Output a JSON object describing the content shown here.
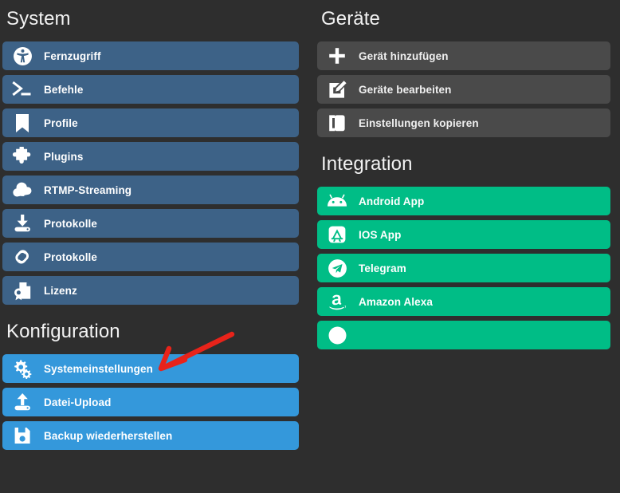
{
  "meta": {
    "accent_steel": "#3d6287",
    "accent_blue": "#3498db",
    "accent_gray": "#4a4a4a",
    "accent_green": "#00bd86",
    "background": "#2e2e2e",
    "annotation_color": "#e8231a"
  },
  "sections": {
    "system": {
      "title": "System",
      "items": [
        {
          "label": "Fernzugriff",
          "icon": "accessibility-icon"
        },
        {
          "label": "Befehle",
          "icon": "terminal-icon"
        },
        {
          "label": "Profile",
          "icon": "bookmark-icon"
        },
        {
          "label": "Plugins",
          "icon": "puzzle-piece-icon"
        },
        {
          "label": "RTMP-Streaming",
          "icon": "cloud-upload-icon"
        },
        {
          "label": "Protokolle",
          "icon": "download-icon"
        },
        {
          "label": "Protokolle",
          "icon": "link-chain-icon"
        },
        {
          "label": "Lizenz",
          "icon": "certificate-icon"
        }
      ]
    },
    "konfiguration": {
      "title": "Konfiguration",
      "items": [
        {
          "label": "Systemeinstellungen",
          "icon": "gears-icon"
        },
        {
          "label": "Datei-Upload",
          "icon": "upload-icon"
        },
        {
          "label": "Backup wiederherstellen",
          "icon": "floppy-disk-icon"
        }
      ]
    },
    "geraete": {
      "title": "Geräte",
      "items": [
        {
          "label": "Gerät hinzufügen",
          "icon": "plus-icon"
        },
        {
          "label": "Geräte bearbeiten",
          "icon": "pencil-square-icon"
        },
        {
          "label": "Einstellungen kopieren",
          "icon": "copy-icon"
        }
      ]
    },
    "integration": {
      "title": "Integration",
      "items": [
        {
          "label": "Android App",
          "icon": "android-icon"
        },
        {
          "label": "IOS App",
          "icon": "app-store-icon"
        },
        {
          "label": "Telegram",
          "icon": "telegram-icon"
        },
        {
          "label": "Amazon Alexa",
          "icon": "amazon-icon"
        },
        {
          "label": "",
          "icon": "partial-icon"
        }
      ]
    }
  },
  "annotation": {
    "type": "arrow",
    "color": "#e8231a",
    "points_to": "Systemeinstellungen"
  }
}
